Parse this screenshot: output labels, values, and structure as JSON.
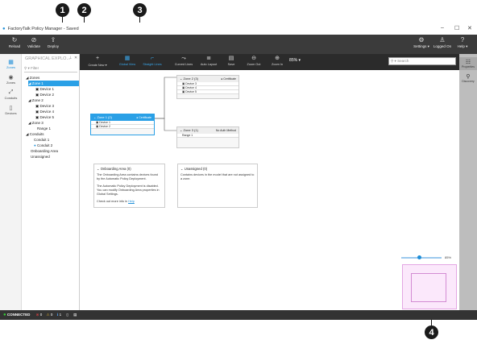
{
  "callouts": [
    "1",
    "2",
    "3",
    "4"
  ],
  "window": {
    "title": "FactoryTalk Policy Manager - Saved"
  },
  "ribbon": {
    "left": [
      {
        "icon": "reload-icon",
        "label": "Reload"
      },
      {
        "icon": "validate-icon",
        "label": "Validate"
      },
      {
        "icon": "deploy-icon",
        "label": "Deploy"
      }
    ],
    "right": [
      {
        "icon": "settings-icon",
        "label": "Settings ▾"
      },
      {
        "icon": "user-icon",
        "label": "Logged On"
      },
      {
        "icon": "help-icon",
        "label": "Help ▾"
      }
    ]
  },
  "leftnav": [
    {
      "icon": "zones-icon",
      "label": "Zones"
    },
    {
      "icon": "zones-icon",
      "label": "Zones"
    },
    {
      "icon": "conduits-icon",
      "label": "Conduits"
    },
    {
      "icon": "devices-icon",
      "label": "Devices"
    }
  ],
  "tree": {
    "header": "GRAPHICAL EXPLO...",
    "filter_placeholder": "Filter",
    "items": [
      "Zones",
      "Zone 1",
      "Device 1",
      "Device 2",
      "Zone 2",
      "Device 3",
      "Device 4",
      "Device 5",
      "Zone 3",
      "Range 1",
      "Conduits",
      "Conduit 1",
      "Conduit 2",
      "Onboarding Area",
      "Unassigned"
    ]
  },
  "toolbar": [
    {
      "icon": "create-new-icon",
      "label": "Create New ▾"
    },
    {
      "icon": "global-view-icon",
      "label": "Global View"
    },
    {
      "icon": "straight-lines-icon",
      "label": "Straight Lines"
    },
    {
      "icon": "curved-lines-icon",
      "label": "Curved Lines"
    },
    {
      "icon": "auto-layout-icon",
      "label": "Auto Layout"
    },
    {
      "icon": "save-icon",
      "label": "Save"
    },
    {
      "icon": "zoom-out-icon",
      "label": "Zoom Out"
    },
    {
      "icon": "zoom-in-icon",
      "label": "Zoom In"
    },
    {
      "icon": "zoom-level",
      "label": "85% ▾"
    }
  ],
  "search": {
    "placeholder": "Search"
  },
  "rightnav": [
    {
      "icon": "properties-icon",
      "label": "Properties"
    },
    {
      "icon": "discovery-icon",
      "label": "Discovery"
    }
  ],
  "zones": {
    "z1": {
      "title": "Zone 1 (2)",
      "badge": "Certificate",
      "devices": [
        "Device 1",
        "Device 2"
      ]
    },
    "z2": {
      "title": "Zone 2 (3)",
      "badge": "Certificate",
      "devices": [
        "Device 3",
        "Device 4",
        "Device 5"
      ]
    },
    "z3": {
      "title": "Zone 3 (1)",
      "badge": "No Auth Method",
      "devices": [
        "Range 1"
      ]
    }
  },
  "onboarding": {
    "title": "Onboarding Area (0)",
    "p1": "The Onboarding Area contains devices found by the Automatic Policy Deployment.",
    "p2": "The Automatic Policy Deployment is disabled. You can modify Onboarding Area properties in Global Settings.",
    "p3": "Check out more info in",
    "link": "Help"
  },
  "unassigned": {
    "title": "Unassigned (0)",
    "p1": "Contains devices in the model that are not assigned to a zone."
  },
  "minimap": {
    "zoom": "85%"
  },
  "status": {
    "connection": "CONNECTED",
    "errors": "0",
    "warnings": "0",
    "info": "1"
  }
}
